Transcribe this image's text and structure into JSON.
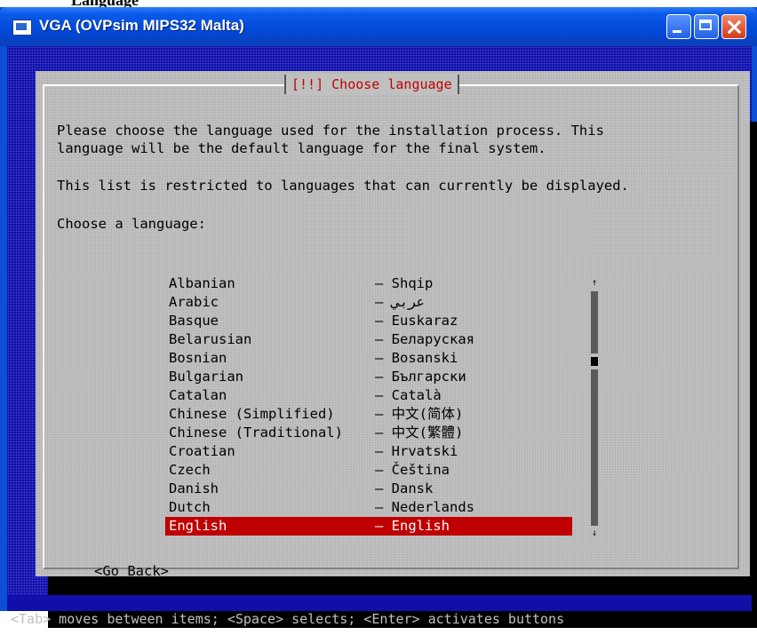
{
  "window": {
    "title": "VGA (OVPsim MIPS32 Malta)",
    "partial_text_above": "Language"
  },
  "dialog": {
    "title": "[!!] Choose language",
    "paragraph1_line1": "Please choose the language used for the installation process. This",
    "paragraph1_line2": "language will be the default language for the final system.",
    "paragraph2": "This list is restricted to languages that can currently be displayed.",
    "prompt": "Choose a language:",
    "go_back": "<Go Back>"
  },
  "languages": [
    {
      "name": "Albanian",
      "native": "– Shqip"
    },
    {
      "name": "Arabic",
      "native": "– عربي"
    },
    {
      "name": "Basque",
      "native": "– Euskaraz"
    },
    {
      "name": "Belarusian",
      "native": "– Беларуская"
    },
    {
      "name": "Bosnian",
      "native": "– Bosanski"
    },
    {
      "name": "Bulgarian",
      "native": "– Български"
    },
    {
      "name": "Catalan",
      "native": "– Català"
    },
    {
      "name": "Chinese (Simplified)",
      "native": "– 中文(简体)"
    },
    {
      "name": "Chinese (Traditional)",
      "native": "– 中文(繁體)"
    },
    {
      "name": "Croatian",
      "native": "– Hrvatski"
    },
    {
      "name": "Czech",
      "native": "– Čeština"
    },
    {
      "name": "Danish",
      "native": "– Dansk"
    },
    {
      "name": "Dutch",
      "native": "– Nederlands"
    },
    {
      "name": "English",
      "native": "– English",
      "selected": true
    }
  ],
  "scrollbar": {
    "up_arrow": "↑",
    "down_arrow": "↓",
    "position_fraction": 0.2
  },
  "status": "<Tab> moves between items; <Space> selects; <Enter> activates buttons",
  "colors": {
    "console_bg": "#1010a8",
    "dialog_bg": "#c0c0c0",
    "title_red": "#c00000",
    "selected_bg": "#c00000",
    "xp_titlebar": "#0049d8"
  }
}
